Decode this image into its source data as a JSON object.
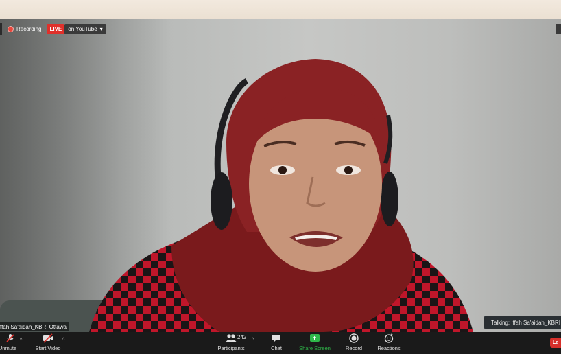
{
  "recording": {
    "label": "Recording"
  },
  "live": {
    "badge": "LIVE",
    "destination": "on YouTube"
  },
  "participant": {
    "name": "ffah Sa'aidah_KBRI Ottawa"
  },
  "talking": {
    "label": "Talking: Iffah Sa'aidah_KBRI"
  },
  "toolbar": {
    "unmute": "Unmute",
    "start_video": "Start Video",
    "participants": "Participants",
    "participants_count": "242",
    "chat": "Chat",
    "share_screen": "Share Screen",
    "record": "Record",
    "reactions": "Reactions",
    "leave": "Le"
  },
  "colors": {
    "live_red": "#e0302b",
    "share_green": "#2fb84a",
    "toolbar_bg": "#1a1a1a"
  }
}
